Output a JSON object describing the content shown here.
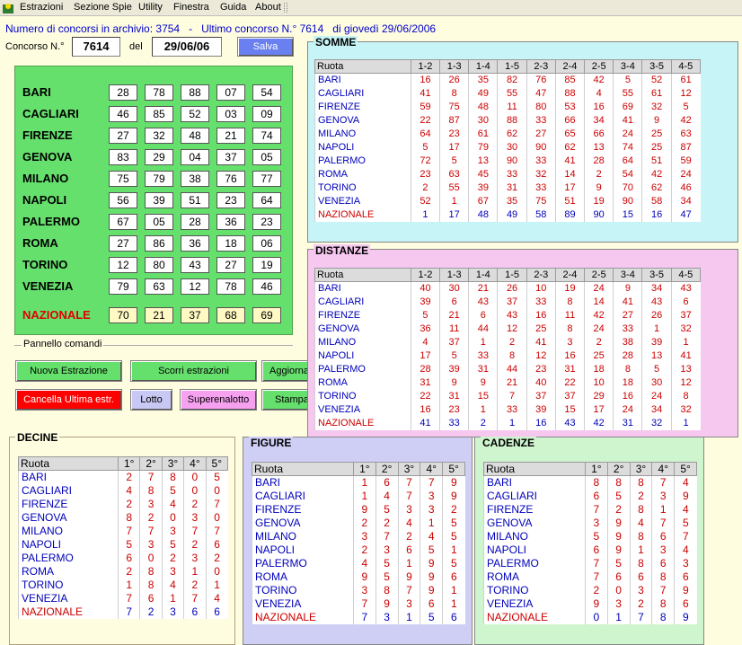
{
  "menu": [
    "Estrazioni",
    "Sezione Spie",
    "Utility",
    "Finestra",
    "Guida",
    "About"
  ],
  "info": {
    "text": "Numero di concorsi in archivio: 3754   -   Ultimo concorso N.° 7614   di giovedì 29/06/2006"
  },
  "concorso": {
    "label": "Concorso N.°",
    "number": "7614",
    "del_label": "del",
    "date": "29/06/06",
    "save": "Salva"
  },
  "estrazione": [
    {
      "ruota": "BARI",
      "n": [
        "28",
        "78",
        "88",
        "07",
        "54"
      ]
    },
    {
      "ruota": "CAGLIARI",
      "n": [
        "46",
        "85",
        "52",
        "03",
        "09"
      ]
    },
    {
      "ruota": "FIRENZE",
      "n": [
        "27",
        "32",
        "48",
        "21",
        "74"
      ]
    },
    {
      "ruota": "GENOVA",
      "n": [
        "83",
        "29",
        "04",
        "37",
        "05"
      ]
    },
    {
      "ruota": "MILANO",
      "n": [
        "75",
        "79",
        "38",
        "76",
        "77"
      ]
    },
    {
      "ruota": "NAPOLI",
      "n": [
        "56",
        "39",
        "51",
        "23",
        "64"
      ]
    },
    {
      "ruota": "PALERMO",
      "n": [
        "67",
        "05",
        "28",
        "36",
        "23"
      ]
    },
    {
      "ruota": "ROMA",
      "n": [
        "27",
        "86",
        "36",
        "18",
        "06"
      ]
    },
    {
      "ruota": "TORINO",
      "n": [
        "12",
        "80",
        "43",
        "27",
        "19"
      ]
    },
    {
      "ruota": "VENEZIA",
      "n": [
        "79",
        "63",
        "12",
        "78",
        "46"
      ]
    },
    {
      "ruota": "NAZIONALE",
      "n": [
        "70",
        "21",
        "37",
        "68",
        "69"
      ]
    }
  ],
  "pannello": {
    "title": "Pannello comandi",
    "nuova": "Nuova Estrazione",
    "scorri": "Scorri estrazioni",
    "aggiorna": "Aggiorna",
    "cancella": "Cancella Ultima estr.",
    "lotto": "Lotto",
    "superenalotto": "Superenalotto",
    "stampa": "Stampa"
  },
  "colors": {
    "green_panel": "#66e06d",
    "red_btn": "#ff0000",
    "lotto_btn": "#c8c8f4",
    "super_btn": "#f6a0f0",
    "salva_btn": "#6a80f0"
  },
  "somme": {
    "title": "SOMME",
    "head": [
      "Ruota",
      "1-2",
      "1-3",
      "1-4",
      "1-5",
      "2-3",
      "2-4",
      "2-5",
      "3-4",
      "3-5",
      "4-5"
    ],
    "rows": [
      [
        "BARI",
        "16",
        "26",
        "35",
        "82",
        "76",
        "85",
        "42",
        "5",
        "52",
        "61"
      ],
      [
        "CAGLIARI",
        "41",
        "8",
        "49",
        "55",
        "47",
        "88",
        "4",
        "55",
        "61",
        "12"
      ],
      [
        "FIRENZE",
        "59",
        "75",
        "48",
        "11",
        "80",
        "53",
        "16",
        "69",
        "32",
        "5"
      ],
      [
        "GENOVA",
        "22",
        "87",
        "30",
        "88",
        "33",
        "66",
        "34",
        "41",
        "9",
        "42"
      ],
      [
        "MILANO",
        "64",
        "23",
        "61",
        "62",
        "27",
        "65",
        "66",
        "24",
        "25",
        "63"
      ],
      [
        "NAPOLI",
        "5",
        "17",
        "79",
        "30",
        "90",
        "62",
        "13",
        "74",
        "25",
        "87"
      ],
      [
        "PALERMO",
        "72",
        "5",
        "13",
        "90",
        "33",
        "41",
        "28",
        "64",
        "51",
        "59"
      ],
      [
        "ROMA",
        "23",
        "63",
        "45",
        "33",
        "32",
        "14",
        "2",
        "54",
        "42",
        "24"
      ],
      [
        "TORINO",
        "2",
        "55",
        "39",
        "31",
        "33",
        "17",
        "9",
        "70",
        "62",
        "46"
      ],
      [
        "VENEZIA",
        "52",
        "1",
        "67",
        "35",
        "75",
        "51",
        "19",
        "90",
        "58",
        "34"
      ],
      [
        "NAZIONALE",
        "1",
        "17",
        "48",
        "49",
        "58",
        "89",
        "90",
        "15",
        "16",
        "47"
      ]
    ]
  },
  "distanze": {
    "title": "DISTANZE",
    "head": [
      "Ruota",
      "1-2",
      "1-3",
      "1-4",
      "1-5",
      "2-3",
      "2-4",
      "2-5",
      "3-4",
      "3-5",
      "4-5"
    ],
    "rows": [
      [
        "BARI",
        "40",
        "30",
        "21",
        "26",
        "10",
        "19",
        "24",
        "9",
        "34",
        "43"
      ],
      [
        "CAGLIARI",
        "39",
        "6",
        "43",
        "37",
        "33",
        "8",
        "14",
        "41",
        "43",
        "6"
      ],
      [
        "FIRENZE",
        "5",
        "21",
        "6",
        "43",
        "16",
        "11",
        "42",
        "27",
        "26",
        "37"
      ],
      [
        "GENOVA",
        "36",
        "11",
        "44",
        "12",
        "25",
        "8",
        "24",
        "33",
        "1",
        "32"
      ],
      [
        "MILANO",
        "4",
        "37",
        "1",
        "2",
        "41",
        "3",
        "2",
        "38",
        "39",
        "1"
      ],
      [
        "NAPOLI",
        "17",
        "5",
        "33",
        "8",
        "12",
        "16",
        "25",
        "28",
        "13",
        "41"
      ],
      [
        "PALERMO",
        "28",
        "39",
        "31",
        "44",
        "23",
        "31",
        "18",
        "8",
        "5",
        "13"
      ],
      [
        "ROMA",
        "31",
        "9",
        "9",
        "21",
        "40",
        "22",
        "10",
        "18",
        "30",
        "12"
      ],
      [
        "TORINO",
        "22",
        "31",
        "15",
        "7",
        "37",
        "37",
        "29",
        "16",
        "24",
        "8"
      ],
      [
        "VENEZIA",
        "16",
        "23",
        "1",
        "33",
        "39",
        "15",
        "17",
        "24",
        "34",
        "32"
      ],
      [
        "NAZIONALE",
        "41",
        "33",
        "2",
        "1",
        "16",
        "43",
        "42",
        "31",
        "32",
        "1"
      ]
    ]
  },
  "decine": {
    "title": "DECINE",
    "head": [
      "Ruota",
      "1°",
      "2°",
      "3°",
      "4°",
      "5°"
    ],
    "rows": [
      [
        "BARI",
        "2",
        "7",
        "8",
        "0",
        "5"
      ],
      [
        "CAGLIARI",
        "4",
        "8",
        "5",
        "0",
        "0"
      ],
      [
        "FIRENZE",
        "2",
        "3",
        "4",
        "2",
        "7"
      ],
      [
        "GENOVA",
        "8",
        "2",
        "0",
        "3",
        "0"
      ],
      [
        "MILANO",
        "7",
        "7",
        "3",
        "7",
        "7"
      ],
      [
        "NAPOLI",
        "5",
        "3",
        "5",
        "2",
        "6"
      ],
      [
        "PALERMO",
        "6",
        "0",
        "2",
        "3",
        "2"
      ],
      [
        "ROMA",
        "2",
        "8",
        "3",
        "1",
        "0"
      ],
      [
        "TORINO",
        "1",
        "8",
        "4",
        "2",
        "1"
      ],
      [
        "VENEZIA",
        "7",
        "6",
        "1",
        "7",
        "4"
      ],
      [
        "NAZIONALE",
        "7",
        "2",
        "3",
        "6",
        "6"
      ]
    ]
  },
  "figure": {
    "title": "FIGURE",
    "head": [
      "Ruota",
      "1°",
      "2°",
      "3°",
      "4°",
      "5°"
    ],
    "rows": [
      [
        "BARI",
        "1",
        "6",
        "7",
        "7",
        "9"
      ],
      [
        "CAGLIARI",
        "1",
        "4",
        "7",
        "3",
        "9"
      ],
      [
        "FIRENZE",
        "9",
        "5",
        "3",
        "3",
        "2"
      ],
      [
        "GENOVA",
        "2",
        "2",
        "4",
        "1",
        "5"
      ],
      [
        "MILANO",
        "3",
        "7",
        "2",
        "4",
        "5"
      ],
      [
        "NAPOLI",
        "2",
        "3",
        "6",
        "5",
        "1"
      ],
      [
        "PALERMO",
        "4",
        "5",
        "1",
        "9",
        "5"
      ],
      [
        "ROMA",
        "9",
        "5",
        "9",
        "9",
        "6"
      ],
      [
        "TORINO",
        "3",
        "8",
        "7",
        "9",
        "1"
      ],
      [
        "VENEZIA",
        "7",
        "9",
        "3",
        "6",
        "1"
      ],
      [
        "NAZIONALE",
        "7",
        "3",
        "1",
        "5",
        "6"
      ]
    ]
  },
  "cadenze": {
    "title": "CADENZE",
    "head": [
      "Ruota",
      "1°",
      "2°",
      "3°",
      "4°",
      "5°"
    ],
    "rows": [
      [
        "BARI",
        "8",
        "8",
        "8",
        "7",
        "4"
      ],
      [
        "CAGLIARI",
        "6",
        "5",
        "2",
        "3",
        "9"
      ],
      [
        "FIRENZE",
        "7",
        "2",
        "8",
        "1",
        "4"
      ],
      [
        "GENOVA",
        "3",
        "9",
        "4",
        "7",
        "5"
      ],
      [
        "MILANO",
        "5",
        "9",
        "8",
        "6",
        "7"
      ],
      [
        "NAPOLI",
        "6",
        "9",
        "1",
        "3",
        "4"
      ],
      [
        "PALERMO",
        "7",
        "5",
        "8",
        "6",
        "3"
      ],
      [
        "ROMA",
        "7",
        "6",
        "6",
        "8",
        "6"
      ],
      [
        "TORINO",
        "2",
        "0",
        "3",
        "7",
        "9"
      ],
      [
        "VENEZIA",
        "9",
        "3",
        "2",
        "8",
        "6"
      ],
      [
        "NAZIONALE",
        "0",
        "1",
        "7",
        "8",
        "9"
      ]
    ]
  }
}
